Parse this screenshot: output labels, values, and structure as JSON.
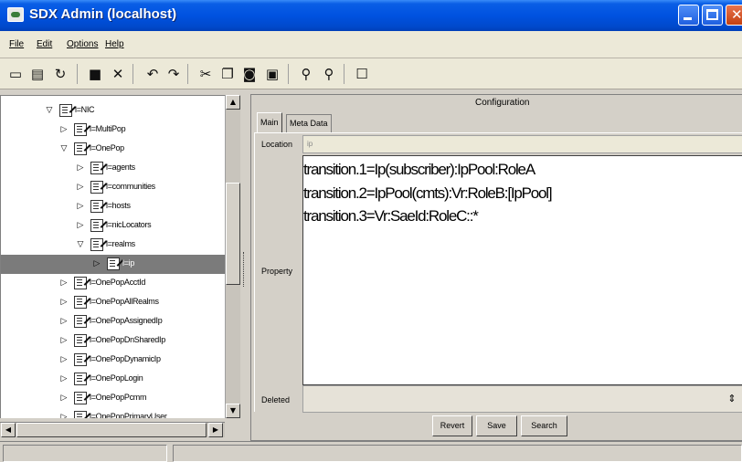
{
  "window": {
    "title": "SDX Admin (localhost)"
  },
  "menu": [
    {
      "label": "File",
      "mnemonic": "F"
    },
    {
      "label": "Edit",
      "mnemonic": "E"
    },
    {
      "label": "Options",
      "mnemonic": "O"
    },
    {
      "label": "Help",
      "mnemonic": "H"
    }
  ],
  "toolbar": {
    "icons": [
      "window-icon",
      "document-icon",
      "refresh-icon",
      "save-icon",
      "delete-icon",
      "undo-icon",
      "redo-icon",
      "cut-icon",
      "copy-icon",
      "camera-icon",
      "paste-icon",
      "find-icon",
      "find-next-icon",
      "properties-icon"
    ]
  },
  "tree": {
    "items": [
      {
        "label": "l=NIC",
        "expander": "▽",
        "depth": 0
      },
      {
        "label": "l=MultiPop",
        "expander": "▷",
        "depth": 1
      },
      {
        "label": "l=OnePop",
        "expander": "▽",
        "depth": 1
      },
      {
        "label": "l=agents",
        "expander": "▷",
        "depth": 2
      },
      {
        "label": "l=communities",
        "expander": "▷",
        "depth": 2
      },
      {
        "label": "l=hosts",
        "expander": "▷",
        "depth": 2
      },
      {
        "label": "l=nicLocators",
        "expander": "▷",
        "depth": 2
      },
      {
        "label": "l=realms",
        "expander": "▽",
        "depth": 2
      },
      {
        "label": "l=ip",
        "expander": "▷",
        "depth": 3,
        "selected": true
      },
      {
        "label": "l=OnePopAcctId",
        "expander": "▷",
        "depth": 1
      },
      {
        "label": "l=OnePopAllRealms",
        "expander": "▷",
        "depth": 1
      },
      {
        "label": "l=OnePopAssignedIp",
        "expander": "▷",
        "depth": 1
      },
      {
        "label": "l=OnePopDnSharedIp",
        "expander": "▷",
        "depth": 1
      },
      {
        "label": "l=OnePopDynamicIp",
        "expander": "▷",
        "depth": 1
      },
      {
        "label": "l=OnePopLogin",
        "expander": "▷",
        "depth": 1
      },
      {
        "label": "l=OnePopPcmm",
        "expander": "▷",
        "depth": 1
      },
      {
        "label": "l=OnePopPrimaryUser",
        "expander": "▷",
        "depth": 1
      }
    ]
  },
  "config": {
    "title": "Configuration",
    "tabs": [
      "Main",
      "Meta Data"
    ],
    "location_label": "Location",
    "location_value": "ip",
    "property_label": "Property",
    "property_lines": [
      "transition.1=Ip(subscriber):IpPool:RoleA",
      "transition.2=IpPool(cmts):Vr:RoleB:[IpPool]",
      "transition.3=Vr:SaeId:RoleC::*"
    ],
    "deleted_label": "Deleted"
  },
  "actions": {
    "revert": "Revert",
    "save": "Save",
    "search": "Search"
  },
  "colors": {
    "titlebar": "#0052e0",
    "selection": "#7b7b7b",
    "chrome": "#d4d0c8"
  }
}
